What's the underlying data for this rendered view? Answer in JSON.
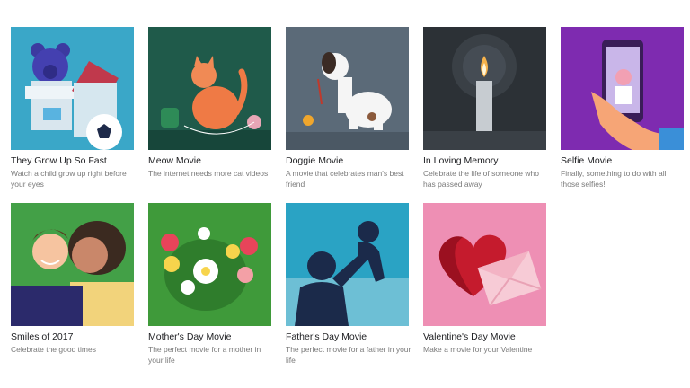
{
  "cards": [
    {
      "title": "They Grow Up So Fast",
      "desc": "Watch a child grow up right before your eyes",
      "bg": "#3aa7c8"
    },
    {
      "title": "Meow Movie",
      "desc": "The internet needs more cat videos",
      "bg": "#1f5a4a"
    },
    {
      "title": "Doggie Movie",
      "desc": "A movie that celebrates man's best friend",
      "bg": "#5b6a78"
    },
    {
      "title": "In Loving Memory",
      "desc": "Celebrate the life of someone who has passed away",
      "bg": "#2c3136"
    },
    {
      "title": "Selfie Movie",
      "desc": "Finally, something to do with all those selfies!",
      "bg": "#7e2bb0"
    },
    {
      "title": "Smiles of 2017",
      "desc": "Celebrate the good times",
      "bg": "#43a047"
    },
    {
      "title": "Mother's Day Movie",
      "desc": "The perfect movie for a mother in your life",
      "bg": "#3f9a3a"
    },
    {
      "title": "Father's Day Movie",
      "desc": "The perfect movie for a father in your life",
      "bg": "#2aa3c4"
    },
    {
      "title": "Valentine's Day Movie",
      "desc": "Make a movie for your Valentine",
      "bg": "#ee8fb4"
    }
  ]
}
